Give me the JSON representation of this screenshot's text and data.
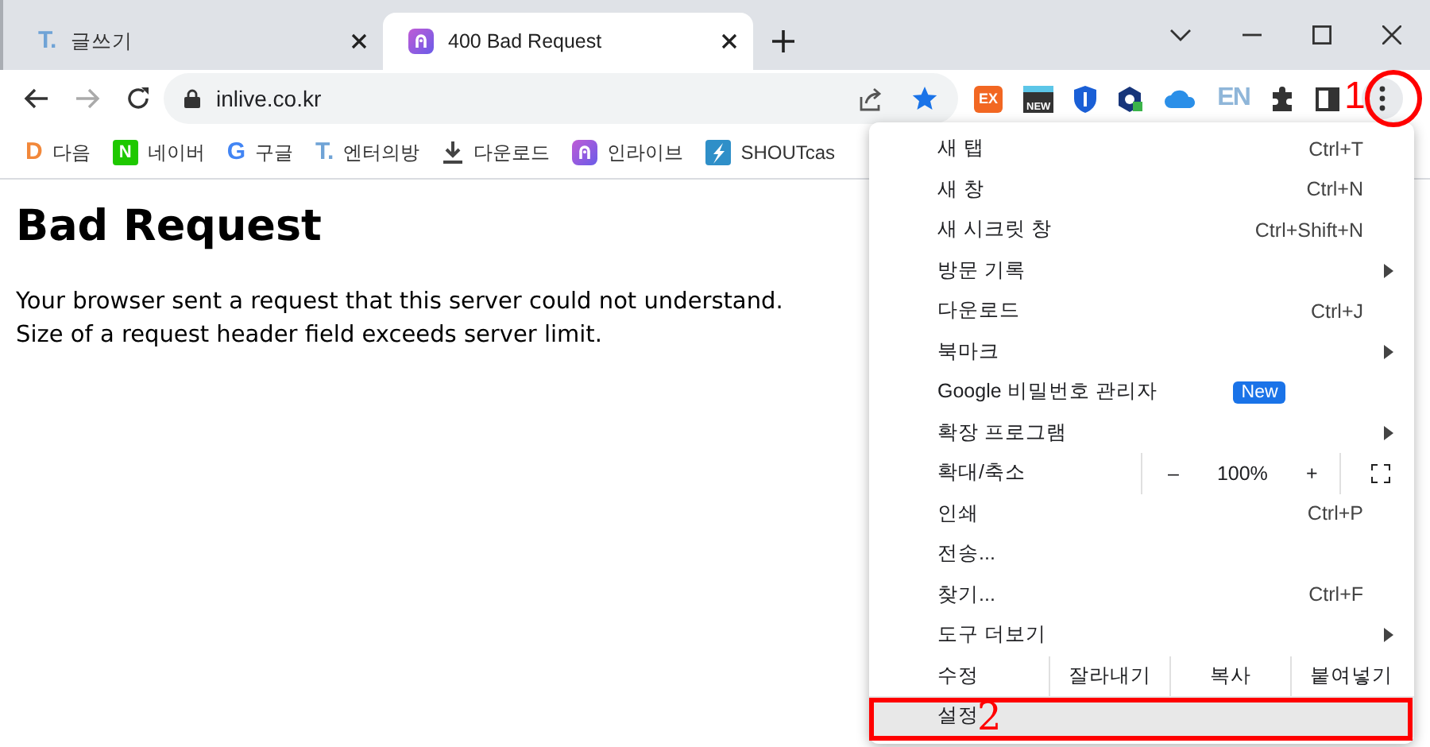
{
  "tabs": [
    {
      "title": "글쓰기",
      "selected": false,
      "favicon": {
        "kind": "letter",
        "text": "T.",
        "color": "#6fa3d6"
      }
    },
    {
      "title": "400 Bad Request",
      "selected": true,
      "favicon": {
        "kind": "inlive"
      }
    }
  ],
  "address_bar": {
    "value": "inlive.co.kr"
  },
  "extensions": [
    {
      "kind": "tile",
      "label": "EX",
      "color": "#f26722"
    },
    {
      "kind": "news",
      "label": "NEW"
    },
    {
      "kind": "shield"
    },
    {
      "kind": "hex"
    },
    {
      "kind": "cloud"
    },
    {
      "kind": "faded",
      "label": "EN"
    }
  ],
  "bookmarks": [
    {
      "label": "다음",
      "icon": {
        "kind": "letter",
        "text": "D",
        "color": "#f2883a"
      }
    },
    {
      "label": "네이버",
      "icon": {
        "kind": "tile",
        "text": "N",
        "color": "#1ec800"
      }
    },
    {
      "label": "구글",
      "icon": {
        "kind": "letter",
        "text": "G",
        "color": "#4285f4"
      }
    },
    {
      "label": "엔터의방",
      "icon": {
        "kind": "letter",
        "text": "T.",
        "color": "#6fa3d6"
      }
    },
    {
      "label": "다운로드",
      "icon": {
        "kind": "download"
      }
    },
    {
      "label": "인라이브",
      "icon": {
        "kind": "inlive"
      }
    },
    {
      "label": "SHOUTcas",
      "icon": {
        "kind": "shout"
      }
    }
  ],
  "page": {
    "heading": "Bad Request",
    "lines": [
      "Your browser sent a request that this server could not understand.",
      "Size of a request header field exceeds server limit."
    ]
  },
  "menu": {
    "items": [
      {
        "kind": "item",
        "label": "새 탭",
        "shortcut": "Ctrl+T",
        "highlighted": false
      },
      {
        "kind": "item",
        "label": "새 창",
        "shortcut": "Ctrl+N",
        "highlighted": false
      },
      {
        "kind": "item",
        "label": "새 시크릿 창",
        "shortcut": "Ctrl+Shift+N",
        "highlighted": false
      },
      {
        "kind": "submenu",
        "label": "방문 기록",
        "highlighted": false
      },
      {
        "kind": "item",
        "label": "다운로드",
        "shortcut": "Ctrl+J",
        "highlighted": false
      },
      {
        "kind": "submenu",
        "label": "북마크",
        "highlighted": false
      },
      {
        "kind": "badge",
        "label": "Google 비밀번호 관리자",
        "badge": "New",
        "highlighted": false
      },
      {
        "kind": "submenu",
        "label": "확장 프로그램",
        "highlighted": false
      },
      {
        "kind": "zoom",
        "label": "확대/축소",
        "minus": "–",
        "value": "100%",
        "plus": "+",
        "highlighted": false
      },
      {
        "kind": "item",
        "label": "인쇄",
        "shortcut": "Ctrl+P",
        "highlighted": false
      },
      {
        "kind": "item",
        "label": "전송...",
        "highlighted": false
      },
      {
        "kind": "item",
        "label": "찾기...",
        "shortcut": "Ctrl+F",
        "highlighted": false
      },
      {
        "kind": "submenu",
        "label": "도구 더보기",
        "highlighted": false
      },
      {
        "kind": "edit",
        "label": "수정",
        "actions": [
          "잘라내기",
          "복사",
          "붙여넣기"
        ],
        "highlighted": false
      },
      {
        "kind": "item",
        "label": "설정",
        "highlighted": true
      }
    ]
  },
  "annotations": [
    {
      "kind": "circle",
      "label": "1"
    },
    {
      "kind": "rect",
      "label": "2"
    }
  ]
}
